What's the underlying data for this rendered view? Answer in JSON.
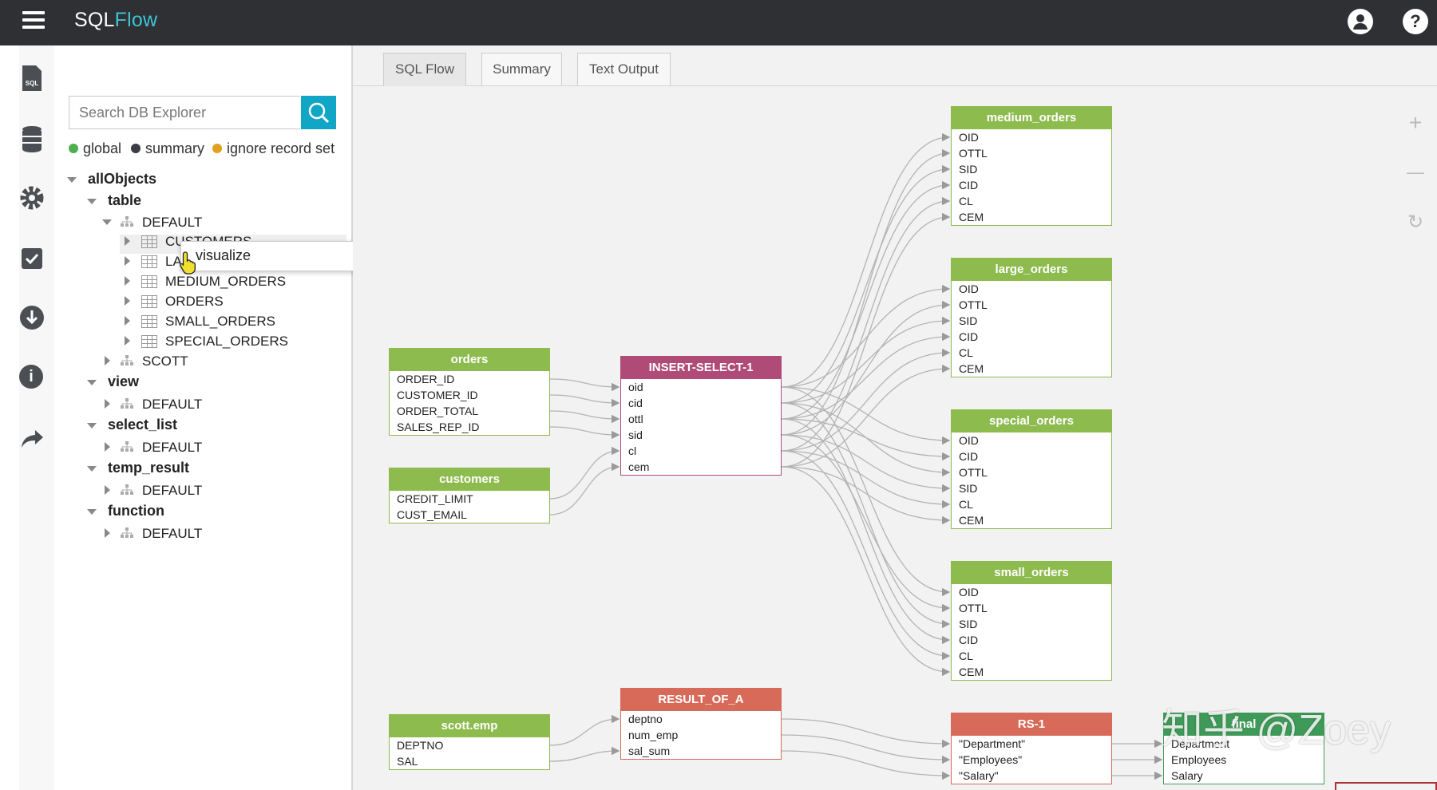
{
  "app": {
    "brand_part1": "SQL",
    "brand_part2": "Flow"
  },
  "explorer": {
    "search_placeholder": "Search DB Explorer",
    "legend": [
      {
        "label": "global",
        "color": "#4caf50"
      },
      {
        "label": "summary",
        "color": "#3a3d44"
      },
      {
        "label": "ignore record set",
        "color": "#e0a020"
      }
    ],
    "tree": {
      "root": "allObjects",
      "table": "table",
      "table_default": "DEFAULT",
      "tables": [
        "CUSTOMERS",
        "LARGE",
        "MEDIUM_ORDERS",
        "ORDERS",
        "SMALL_ORDERS",
        "SPECIAL_ORDERS"
      ],
      "tables_shown": [
        "CUSTOMERS",
        "LA",
        "MEDIUM_ORDERS",
        "ORDERS",
        "SMALL_ORDERS",
        "SPECIAL_ORDERS"
      ],
      "scott": "SCOTT",
      "view": "view",
      "view_default": "DEFAULT",
      "select_list": "select_list",
      "select_default": "DEFAULT",
      "temp_result": "temp_result",
      "temp_default": "DEFAULT",
      "function": "function",
      "function_default": "DEFAULT"
    },
    "context_menu": {
      "item": "visualize"
    }
  },
  "tabs": [
    "SQL Flow",
    "Summary",
    "Text Output"
  ],
  "active_tab": "SQL Flow",
  "zoom": {
    "in": "+",
    "out": "—",
    "reset": "↻"
  },
  "nodes": {
    "orders": {
      "title": "orders",
      "fields": [
        "ORDER_ID",
        "CUSTOMER_ID",
        "ORDER_TOTAL",
        "SALES_REP_ID"
      ]
    },
    "customers": {
      "title": "customers",
      "fields": [
        "CREDIT_LIMIT",
        "CUST_EMAIL"
      ]
    },
    "insert": {
      "title": "INSERT-SELECT-1",
      "fields": [
        "oid",
        "cid",
        "ottl",
        "sid",
        "cl",
        "cem"
      ]
    },
    "medium": {
      "title": "medium_orders",
      "fields": [
        "OID",
        "OTTL",
        "SID",
        "CID",
        "CL",
        "CEM"
      ]
    },
    "large": {
      "title": "large_orders",
      "fields": [
        "OID",
        "OTTL",
        "SID",
        "CID",
        "CL",
        "CEM"
      ]
    },
    "special": {
      "title": "special_orders",
      "fields": [
        "OID",
        "CID",
        "OTTL",
        "SID",
        "CL",
        "CEM"
      ]
    },
    "small": {
      "title": "small_orders",
      "fields": [
        "OID",
        "OTTL",
        "SID",
        "CID",
        "CL",
        "CEM"
      ]
    },
    "scottemp": {
      "title": "scott.emp",
      "fields": [
        "DEPTNO",
        "SAL"
      ]
    },
    "result": {
      "title": "RESULT_OF_A",
      "fields": [
        "deptno",
        "num_emp",
        "sal_sum"
      ]
    },
    "rs1": {
      "title": "RS-1",
      "fields": [
        "\"Department\"",
        "\"Employees\"",
        "\"Salary\""
      ]
    },
    "final": {
      "title": "final",
      "fields": [
        "Department",
        "Employees",
        "Salary"
      ]
    }
  },
  "watermark": "知乎 @Zoey"
}
